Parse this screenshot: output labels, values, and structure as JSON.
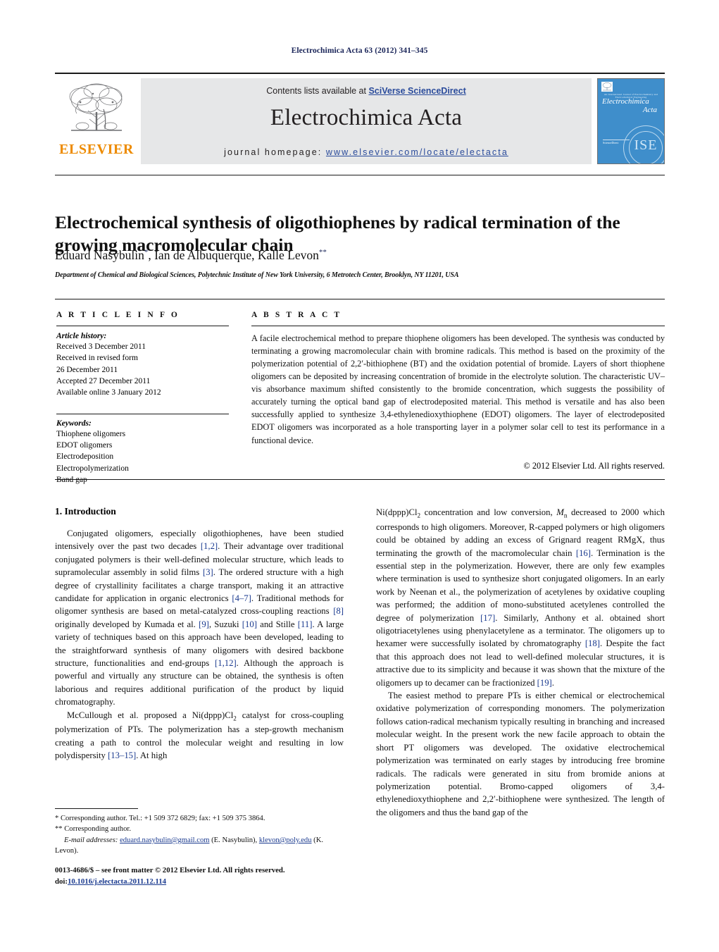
{
  "running_head": "Electrochimica Acta 63 (2012) 341–345",
  "masthead": {
    "elsevier_wordmark": "ELSEVIER",
    "contents_prefix": "Contents lists available at ",
    "contents_link": "SciVerse ScienceDirect",
    "journal_title": "Electrochimica Acta",
    "homepage_prefix": "journal homepage: ",
    "homepage_url": "www.elsevier.com/locate/electacta",
    "cover": {
      "society_line": "An International Journal of Electrochemistry and Electrochemical Engineering",
      "title_line1": "Electrochimica",
      "title_line2": "Acta",
      "sciencedirect": "ScienceDirect",
      "seal": "ISE"
    }
  },
  "article": {
    "title": "Electrochemical synthesis of oligothiophenes by radical termination of the growing macromolecular chain",
    "authors_html": "Eduard Nasybulin<sup>*</sup>, Ian de Albuquerque, Kalle Levon<sup>**</sup>",
    "affiliation": "Department of Chemical and Biological Sciences, Polytechnic Institute of New York University, 6 Metrotech Center, Brooklyn, NY 11201, USA"
  },
  "info": {
    "label": "A R T I C L E    I N F O",
    "history_head": "Article history:",
    "history": [
      "Received 3 December 2011",
      "Received in revised form",
      "26 December 2011",
      "Accepted 27 December 2011",
      "Available online 3 January 2012"
    ],
    "keywords_head": "Keywords:",
    "keywords": [
      "Thiophene oligomers",
      "EDOT oligomers",
      "Electrodeposition",
      "Electropolymerization",
      "Band gap"
    ]
  },
  "abstract": {
    "label": "A B S T R A C T",
    "text": "A facile electrochemical method to prepare thiophene oligomers has been developed. The synthesis was conducted by terminating a growing macromolecular chain with bromine radicals. This method is based on the proximity of the polymerization potential of 2,2′-bithiophene (BT) and the oxidation potential of bromide. Layers of short thiophene oligomers can be deposited by increasing concentration of bromide in the electrolyte solution. The characteristic UV–vis absorbance maximum shifted consistently to the bromide concentration, which suggests the possibility of accurately turning the optical band gap of electrodeposited material. This method is versatile and has also been successfully applied to synthesize 3,4-ethylenedioxythiophene (EDOT) oligomers. The layer of electrodeposited EDOT oligomers was incorporated as a hole transporting layer in a polymer solar cell to test its performance in a functional device.",
    "copyright": "© 2012 Elsevier Ltd. All rights reserved."
  },
  "body": {
    "section_title": "1.  Introduction",
    "left_paragraphs_html": [
      "Conjugated oligomers, especially oligothiophenes, have been studied intensively over the past two decades <span class=\"cite\">[1,2]</span>. Their advantage over traditional conjugated polymers is their well-defined molecular structure, which leads to supramolecular assembly in solid films <span class=\"cite\">[3]</span>. The ordered structure with a high degree of crystallinity facilitates a charge transport, making it an attractive candidate for application in organic electronics <span class=\"cite\">[4–7]</span>. Traditional methods for oligomer synthesis are based on metal-catalyzed cross-coupling reactions <span class=\"cite\">[8]</span> originally developed by Kumada et al. <span class=\"cite\">[9]</span>, Suzuki <span class=\"cite\">[10]</span> and Stille <span class=\"cite\">[11]</span>. A large variety of techniques based on this approach have been developed, leading to the straightforward synthesis of many oligomers with desired backbone structure, functionalities and end-groups <span class=\"cite\">[1,12]</span>. Although the approach is powerful and virtually any structure can be obtained, the synthesis is often laborious and requires additional purification of the product by liquid chromatography.",
      "McCullough et al. proposed a Ni(dppp)Cl<sub>2</sub> catalyst for cross-coupling polymerization of PTs. The polymerization has a step-growth mechanism creating a path to control the molecular weight and resulting in low polydispersity <span class=\"cite\">[13–15]</span>. At high"
    ],
    "right_paragraphs_html": [
      "Ni(dppp)Cl<sub>2</sub> concentration and low conversion, <i>M</i><sub>n</sub> decreased to 2000 which corresponds to high oligomers. Moreover, R-capped polymers or high oligomers could be obtained by adding an excess of Grignard reagent RMgX, thus terminating the growth of the macromolecular chain <span class=\"cite\">[16]</span>. Termination is the essential step in the polymerization. However, there are only few examples where termination is used to synthesize short conjugated oligomers. In an early work by Neenan et al., the polymerization of acetylenes by oxidative coupling was performed; the addition of mono-substituted acetylenes controlled the degree of polymerization <span class=\"cite\">[17]</span>. Similarly, Anthony et al. obtained short oligotriacetylenes using phenylacetylene as a terminator. The oligomers up to hexamer were successfully isolated by chromatography <span class=\"cite\">[18]</span>. Despite the fact that this approach does not lead to well-defined molecular structures, it is attractive due to its simplicity and because it was shown that the mixture of the oligomers up to decamer can be fractionized <span class=\"cite\">[19]</span>.",
      "The easiest method to prepare PTs is either chemical or electrochemical oxidative polymerization of corresponding monomers. The polymerization follows cation-radical mechanism typically resulting in branching and increased molecular weight. In the present work the new facile approach to obtain the short PT oligomers was developed. The oxidative electrochemical polymerization was terminated on early stages by introducing free bromine radicals. The radicals were generated in situ from bromide anions at polymerization potential. Bromo-capped oligomers of 3,4-ethylenedioxythiophene and 2,2′-bithiophene were synthesized. The length of the oligomers and thus the band gap of the"
    ]
  },
  "footnotes": {
    "corresponding_1": "* Corresponding author. Tel.: +1 509 372 6829; fax: +1 509 375 3864.",
    "corresponding_2": "** Corresponding author.",
    "email_label": "E-mail addresses:",
    "email_1": "eduard.nasybulin@gmail.com",
    "email_1_owner": "(E. Nasybulin)",
    "email_2": "klevon@poly.edu",
    "email_2_owner": "(K. Levon).",
    "imprint": "0013-4686/$ – see front matter © 2012 Elsevier Ltd. All rights reserved.",
    "doi_label": "doi:",
    "doi": "10.1016/j.electacta.2011.12.114"
  }
}
